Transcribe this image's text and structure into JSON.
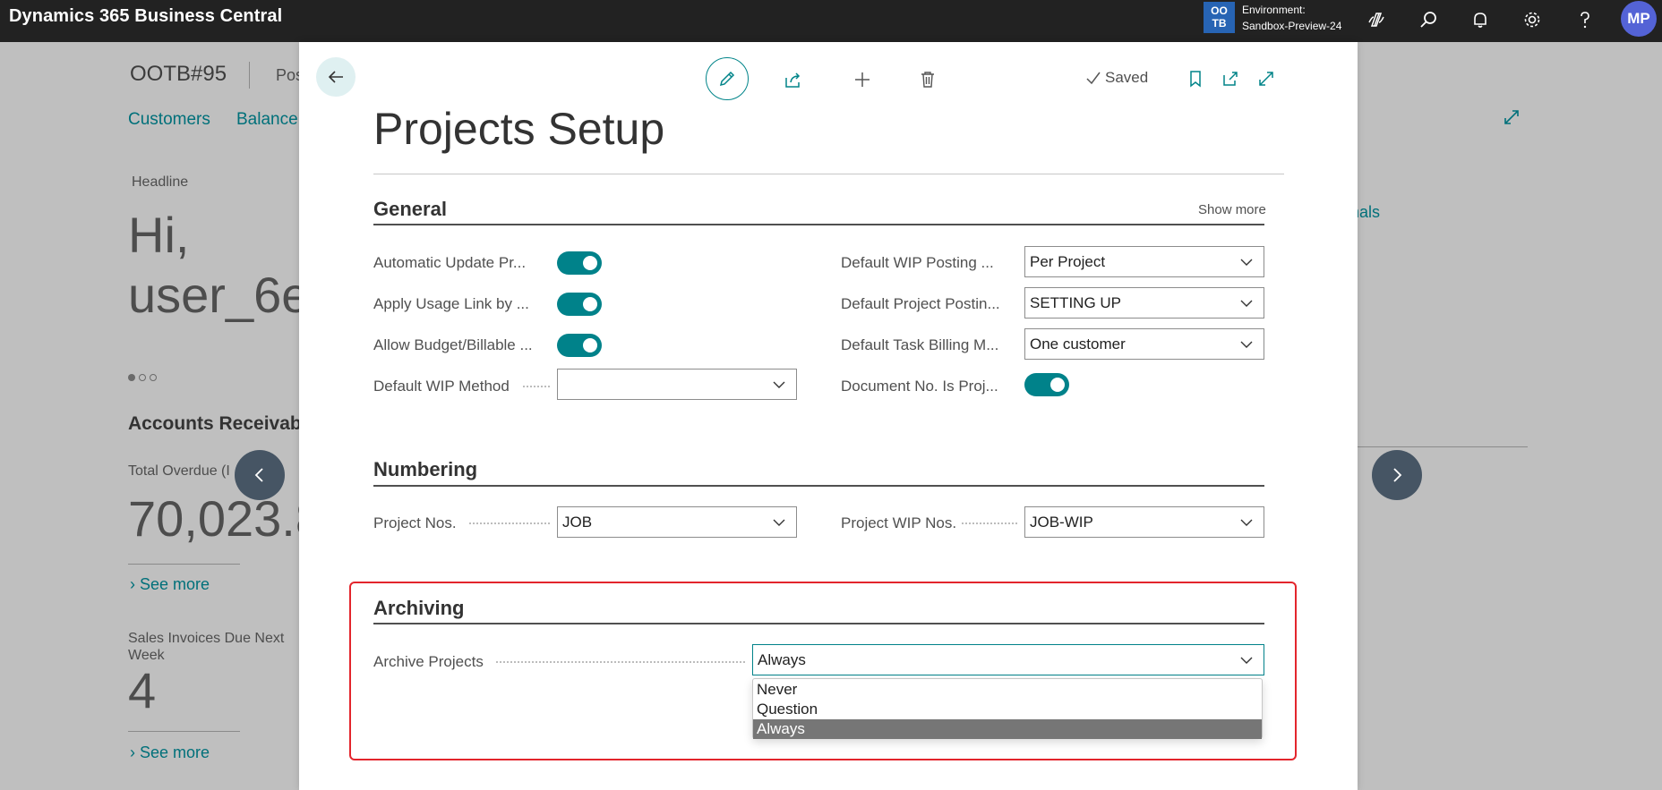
{
  "topbar": {
    "brand": "Dynamics 365 Business Central",
    "env_badge_line1": "OO",
    "env_badge_line2": "TB",
    "env_label": "Environment:",
    "env_name": "Sandbox-Preview-24",
    "avatar_initials": "MP",
    "icons": [
      "copilot-icon",
      "search-icon",
      "bell-icon",
      "gear-icon",
      "help-icon"
    ]
  },
  "background": {
    "company": "OOTB#95",
    "company_suffix": "Pos",
    "nav_customers": "Customers",
    "nav_balance": "Balance",
    "headline_label": "Headline",
    "greeting_line1": "Hi,",
    "greeting_line2": "user_6e",
    "section_ar": "Accounts Receivabl",
    "total_overdue_label": "Total Overdue (I",
    "total_overdue_value": "70,023.8",
    "see_more_1": "See more",
    "sales_invoices_label_1": "Sales Invoices Due Next",
    "sales_invoices_label_2": "Week",
    "sales_invoices_value": "4",
    "see_more_2": "See more",
    "right_link_fragment": "nals"
  },
  "dialog": {
    "saved_label": "Saved",
    "title": "Projects Setup",
    "general": {
      "title": "General",
      "show_more": "Show more",
      "left_fields": [
        {
          "label": "Automatic Update Pr...",
          "type": "toggle",
          "value": true
        },
        {
          "label": "Apply Usage Link by ...",
          "type": "toggle",
          "value": true
        },
        {
          "label": "Allow Budget/Billable ...",
          "type": "toggle",
          "value": true
        },
        {
          "label": "Default WIP Method",
          "type": "select",
          "value": ""
        }
      ],
      "right_fields": [
        {
          "label": "Default WIP Posting ...",
          "type": "select",
          "value": "Per Project"
        },
        {
          "label": "Default Project Postin...",
          "type": "select",
          "value": "SETTING UP"
        },
        {
          "label": "Default Task Billing M...",
          "type": "select",
          "value": "One customer"
        },
        {
          "label": "Document No. Is Proj...",
          "type": "toggle",
          "value": true
        }
      ]
    },
    "numbering": {
      "title": "Numbering",
      "project_nos_label": "Project Nos.",
      "project_nos_value": "JOB",
      "project_wip_nos_label": "Project WIP Nos.",
      "project_wip_nos_value": "JOB-WIP"
    },
    "archiving": {
      "title": "Archiving",
      "archive_projects_label": "Archive Projects",
      "archive_projects_value": "Always",
      "options": [
        "Never",
        "Question",
        "Always"
      ],
      "selected_option": "Always"
    }
  },
  "colors": {
    "accent": "#00828a",
    "topbar": "#222222",
    "highlight": "#e3252c",
    "avatar": "#5463d6",
    "env_badge": "#2764b4"
  }
}
